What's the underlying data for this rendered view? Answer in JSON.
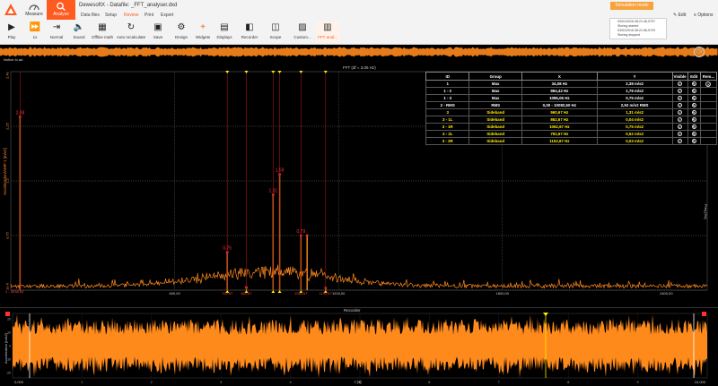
{
  "app": {
    "title": "DewesoftX - Datafile: _FFT_analyser.dxd",
    "modes": [
      {
        "label": "Measure",
        "icon": "gauge-icon"
      },
      {
        "label": "Analyze",
        "icon": "magnifier-icon"
      }
    ],
    "menu_tabs": [
      "Data files",
      "Setup",
      "Review",
      "Print",
      "Export"
    ],
    "active_tab": "Review",
    "tools": [
      {
        "label": "Play",
        "icon": "play-icon"
      },
      {
        "label": "1x",
        "icon": "fast-forward-icon"
      },
      {
        "label": "Normal",
        "icon": "step-icon"
      },
      {
        "label": "Sound",
        "icon": "speaker-icon"
      },
      {
        "label": "Offline math",
        "icon": "calculator-icon"
      },
      {
        "label": "Auto recalculate",
        "icon": "recalculate-icon"
      },
      {
        "label": "Save",
        "icon": "save-icon"
      },
      {
        "label": "Design",
        "icon": "gear-icon"
      },
      {
        "label": "Widgets",
        "icon": "plus-icon"
      },
      {
        "label": "Displays",
        "icon": "displays-icon"
      },
      {
        "label": "Recorder",
        "icon": "recorder-icon"
      },
      {
        "label": "Scope",
        "icon": "scope-icon"
      },
      {
        "label": "Custom...",
        "icon": "custom-display-icon"
      },
      {
        "label": "FFT anal...",
        "icon": "fft-icon"
      }
    ],
    "simulation_badge": "Simulation mode",
    "edit_label": "Edit",
    "options_label": "Options",
    "event_log": [
      "03/01/2016 08:21:46,9797 Storing started",
      "03/01/2016 08:21:56,9729 Storing stopped"
    ]
  },
  "overview": {
    "marker_label": "Notice /p.ad",
    "color": "#ff8a1c"
  },
  "fft": {
    "title": "FFT (df = 3,05 Hz)",
    "y_label": "Acceleration/AMP 1 [m/s2]",
    "x_label": "Freq [Hz]",
    "cursor_min_label": "2 - 3038,83",
    "y_ticks": [
      "2,4e",
      "2,25",
      "1,5",
      "0,75",
      "1e-6"
    ],
    "x_ticks": [
      "0,00",
      "600,00",
      "1200,00",
      "1800,00",
      "2400,00"
    ],
    "peak_labels": [
      {
        "label": "2,38",
        "color": "#ff3030"
      },
      {
        "label": "1,59",
        "color": "#ff3030"
      },
      {
        "label": "1,31",
        "color": "#ff3030"
      },
      {
        "label": "0,79",
        "color": "#ff3030"
      },
      {
        "label": "0,75",
        "color": "#ff3030"
      }
    ],
    "cursor_x_labels": [
      "792,87",
      "862,67",
      "1062,67",
      "1152,67"
    ],
    "colors": {
      "trace": "#ff8a1c",
      "cursor": "#ff3030",
      "marker": "#ffee00"
    }
  },
  "chart_data": {
    "type": "line",
    "title": "FFT (df = 3,05 Hz)",
    "xlabel": "Freq [Hz]",
    "ylabel": "Acceleration/AMP 1 [m/s2]",
    "xlim": [
      0,
      2550
    ],
    "ylim": [
      0,
      3
    ],
    "peaks": [
      {
        "x": 34.08,
        "y": 2.38
      },
      {
        "x": 984.42,
        "y": 1.59
      },
      {
        "x": 1085.05,
        "y": 0.75
      },
      {
        "x": 960.67,
        "y": 1.31
      },
      {
        "x": 862.67,
        "y": 0.04
      },
      {
        "x": 1062.67,
        "y": 0.75
      },
      {
        "x": 792.67,
        "y": 0.52
      },
      {
        "x": 1152.67,
        "y": 0.03
      }
    ]
  },
  "cursor_table": {
    "headers": [
      "ID",
      "Group",
      "X",
      "Y",
      "Visible",
      "Edit",
      "Rem..."
    ],
    "rows": [
      {
        "id": "1",
        "group": "Max",
        "x": "34,08 Hz",
        "y": "2,38 m/s2",
        "yellow": false
      },
      {
        "id": "1 - 2",
        "group": "Max",
        "x": "984,42 Hz",
        "y": "1,79 m/s2",
        "yellow": false
      },
      {
        "id": "1 - 3",
        "group": "Max",
        "x": "1085,05 Hz",
        "y": "0,75 m/s2",
        "yellow": false
      },
      {
        "id": "2 - RMS",
        "group": "RMS",
        "x": "0,00 - 10082,50 Hz",
        "y": "2,92 m/s2 RMS",
        "yellow": false
      },
      {
        "id": "3",
        "group": "Sideband",
        "x": "960,67 Hz",
        "y": "1,31 m/s2",
        "yellow": true
      },
      {
        "id": "3 - 1L",
        "group": "Sideband",
        "x": "862,67 Hz",
        "y": "0,04 m/s2",
        "yellow": true
      },
      {
        "id": "3 - 1R",
        "group": "Sideband",
        "x": "1062,67 Hz",
        "y": "0,75 m/s2",
        "yellow": true
      },
      {
        "id": "3 - 2L",
        "group": "Sideband",
        "x": "792,67 Hz",
        "y": "0,52 m/s2",
        "yellow": true
      },
      {
        "id": "3 - 2R",
        "group": "Sideband",
        "x": "1152,67 Hz",
        "y": "0,03 m/s2",
        "yellow": true
      }
    ]
  },
  "recorder": {
    "title": "Recorder",
    "y_label": "Acceleration [m/s2]",
    "x_label": "t (s)",
    "left_time": "0,000",
    "right_time": "10,000",
    "y_ticks": [
      "20",
      "10",
      "0",
      "-10",
      "-20"
    ],
    "x_ticks": [
      "1",
      "2",
      "3",
      "4",
      "5",
      "6",
      "7",
      "8",
      "9"
    ]
  }
}
